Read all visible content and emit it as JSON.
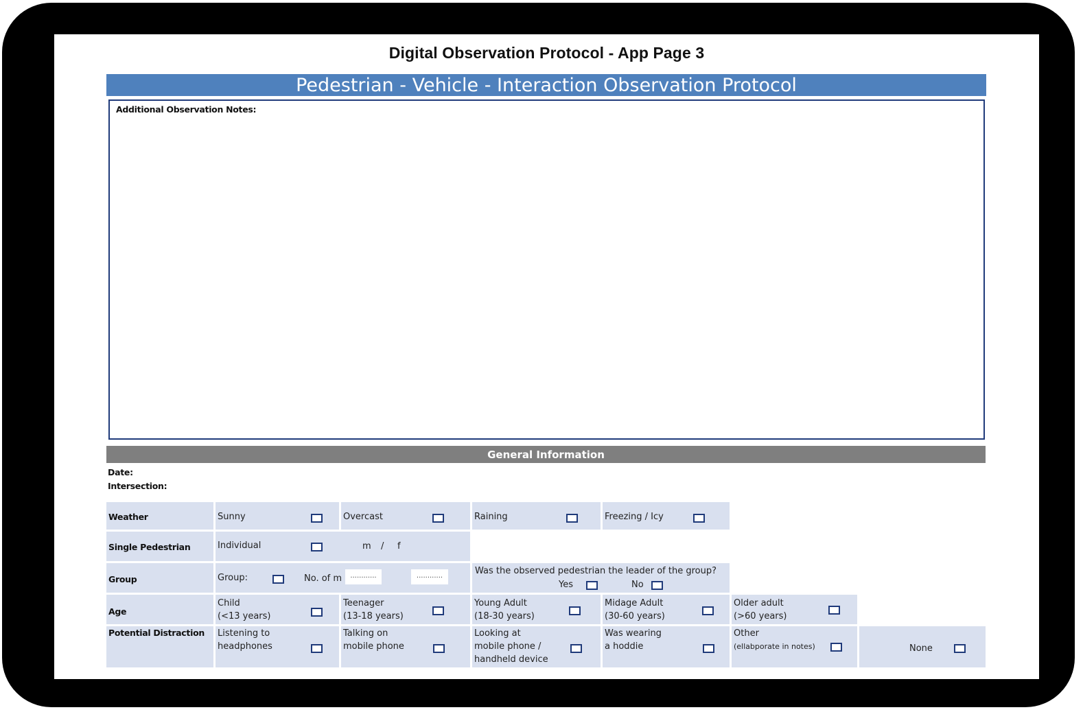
{
  "page": {
    "title": "Digital Observation Protocol - App Page 3",
    "banner": "Pedestrian - Vehicle - Interaction Observation Protocol",
    "notes_label": "Additional Observation Notes:",
    "section_title": "General Information",
    "date_label": "Date:",
    "intersection_label": "Intersection:"
  },
  "weather": {
    "label": "Weather",
    "options": [
      "Sunny",
      "Overcast",
      "Raining",
      "Freezing / Icy"
    ]
  },
  "single": {
    "label": "Single Pedestrian",
    "individual": "Individual",
    "mf_m": "m",
    "mf_slash": "/",
    "mf_f": "f"
  },
  "group": {
    "label": "Group",
    "group_option": "Group:",
    "count_label": "No. of m",
    "count_m_placeholder": "............",
    "count_f_placeholder": "............",
    "leader_question": "Was the observed pedestrian the leader of the group?",
    "yes": "Yes",
    "no": "No"
  },
  "age": {
    "label": "Age",
    "options": [
      {
        "line1": "Child",
        "line2": "(<13 years)"
      },
      {
        "line1": "Teenager",
        "line2": "(13-18 years)"
      },
      {
        "line1": "Young Adult",
        "line2": "(18-30 years)"
      },
      {
        "line1": "Midage Adult",
        "line2": "(30-60 years)"
      },
      {
        "line1": "Older adult",
        "line2": "(>60 years)"
      }
    ]
  },
  "distraction": {
    "label": "Potential Distraction",
    "options": [
      {
        "line1": "Listening to",
        "line2": "headphones",
        "line3": ""
      },
      {
        "line1": "Talking on",
        "line2": "mobile phone",
        "line3": ""
      },
      {
        "line1": "Looking at",
        "line2": "mobile phone /",
        "line3": "handheld device"
      },
      {
        "line1": "Was wearing",
        "line2": "a hoddie",
        "line3": ""
      },
      {
        "line1": "Other",
        "line2": "(ellabporate in notes)",
        "line3": ""
      }
    ],
    "none": "None"
  }
}
